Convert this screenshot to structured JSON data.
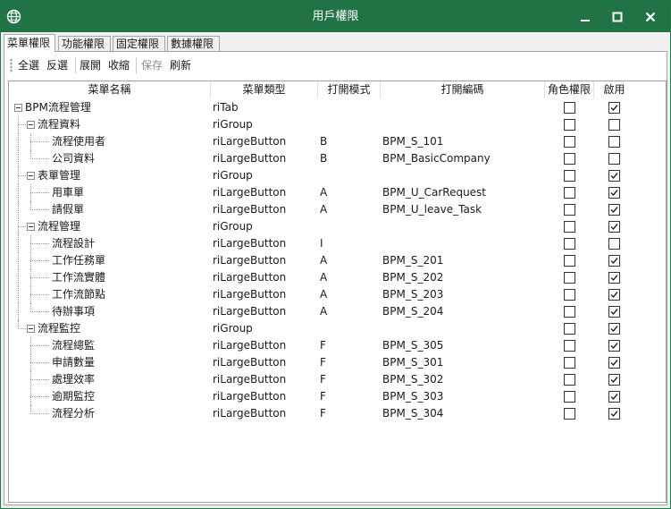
{
  "window": {
    "title": "用戶權限",
    "accent": "#217346"
  },
  "tabs": [
    {
      "label": "菜單權限",
      "active": true
    },
    {
      "label": "功能權限",
      "active": false
    },
    {
      "label": "固定權限",
      "active": false
    },
    {
      "label": "數據權限",
      "active": false
    }
  ],
  "toolbar": {
    "select_all": "全選",
    "invert": "反選",
    "expand": "展開",
    "collapse": "收縮",
    "save": "保存",
    "refresh": "刷新"
  },
  "columns": {
    "name": "菜單名稱",
    "type": "菜單類型",
    "mode": "打開模式",
    "code": "打開編碼",
    "role": "角色權限",
    "enabled": "啟用"
  },
  "rows": [
    {
      "name": "BPM流程管理",
      "level": 0,
      "group": true,
      "type": "riTab",
      "mode": "",
      "code": "",
      "role": false,
      "enabled": true
    },
    {
      "name": "流程資料",
      "level": 1,
      "group": true,
      "type": "riGroup",
      "mode": "",
      "code": "",
      "role": false,
      "enabled": false
    },
    {
      "name": "流程使用者",
      "level": 2,
      "group": false,
      "type": "riLargeButton",
      "mode": "B",
      "code": "BPM_S_101",
      "role": false,
      "enabled": false
    },
    {
      "name": "公司資料",
      "level": 2,
      "group": false,
      "type": "riLargeButton",
      "mode": "B",
      "code": "BPM_BasicCompany",
      "role": false,
      "enabled": false
    },
    {
      "name": "表單管理",
      "level": 1,
      "group": true,
      "type": "riGroup",
      "mode": "",
      "code": "",
      "role": false,
      "enabled": true
    },
    {
      "name": "用車單",
      "level": 2,
      "group": false,
      "type": "riLargeButton",
      "mode": "A",
      "code": "BPM_U_CarRequest",
      "role": false,
      "enabled": true
    },
    {
      "name": "請假單",
      "level": 2,
      "group": false,
      "type": "riLargeButton",
      "mode": "A",
      "code": "BPM_U_leave_Task",
      "role": false,
      "enabled": true
    },
    {
      "name": "流程管理",
      "level": 1,
      "group": true,
      "type": "riGroup",
      "mode": "",
      "code": "",
      "role": false,
      "enabled": true
    },
    {
      "name": "流程設計",
      "level": 2,
      "group": false,
      "type": "riLargeButton",
      "mode": "I",
      "code": "",
      "role": false,
      "enabled": false
    },
    {
      "name": "工作任務單",
      "level": 2,
      "group": false,
      "type": "riLargeButton",
      "mode": "A",
      "code": "BPM_S_201",
      "role": false,
      "enabled": true
    },
    {
      "name": "工作流實體",
      "level": 2,
      "group": false,
      "type": "riLargeButton",
      "mode": "A",
      "code": "BPM_S_202",
      "role": false,
      "enabled": true
    },
    {
      "name": "工作流節點",
      "level": 2,
      "group": false,
      "type": "riLargeButton",
      "mode": "A",
      "code": "BPM_S_203",
      "role": false,
      "enabled": true
    },
    {
      "name": "待辦事項",
      "level": 2,
      "group": false,
      "type": "riLargeButton",
      "mode": "A",
      "code": "BPM_S_204",
      "role": false,
      "enabled": true
    },
    {
      "name": "流程監控",
      "level": 1,
      "group": true,
      "type": "riGroup",
      "mode": "",
      "code": "",
      "role": false,
      "enabled": true
    },
    {
      "name": "流程總監",
      "level": 2,
      "group": false,
      "type": "riLargeButton",
      "mode": "F",
      "code": "BPM_S_305",
      "role": false,
      "enabled": true
    },
    {
      "name": "申請數量",
      "level": 2,
      "group": false,
      "type": "riLargeButton",
      "mode": "F",
      "code": "BPM_S_301",
      "role": false,
      "enabled": true
    },
    {
      "name": "處理效率",
      "level": 2,
      "group": false,
      "type": "riLargeButton",
      "mode": "F",
      "code": "BPM_S_302",
      "role": false,
      "enabled": true
    },
    {
      "name": "逾期監控",
      "level": 2,
      "group": false,
      "type": "riLargeButton",
      "mode": "F",
      "code": "BPM_S_303",
      "role": false,
      "enabled": true
    },
    {
      "name": "流程分析",
      "level": 2,
      "group": false,
      "type": "riLargeButton",
      "mode": "F",
      "code": "BPM_S_304",
      "role": false,
      "enabled": true
    }
  ]
}
